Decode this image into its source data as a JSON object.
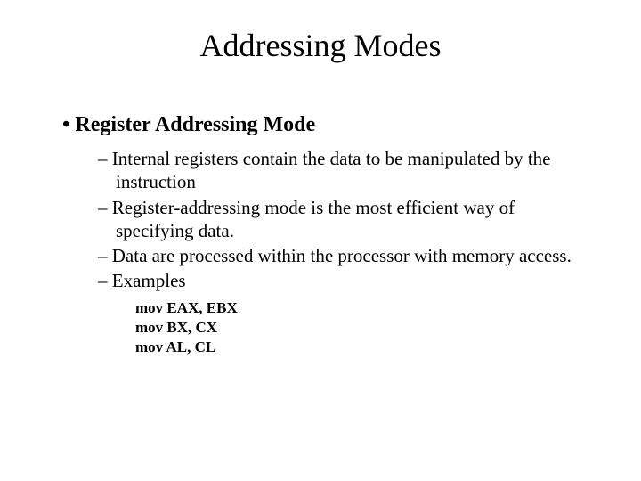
{
  "title": "Addressing Modes",
  "level1": "Register Addressing Mode",
  "level2": [
    "Internal registers contain the data to be manipulated by the instruction",
    "Register-addressing mode is the most efficient way of specifying data.",
    "Data are processed within the processor with memory access.",
    "Examples"
  ],
  "code": [
    "mov EAX, EBX",
    "mov BX, CX",
    "mov AL, CL"
  ]
}
